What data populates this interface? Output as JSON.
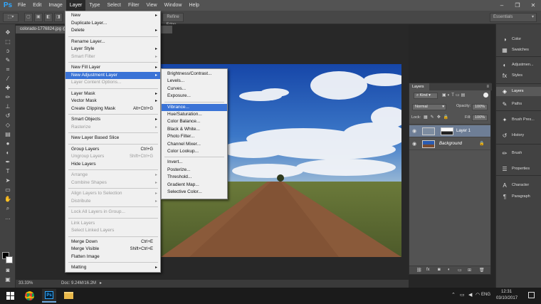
{
  "app": {
    "logo": "Ps"
  },
  "menubar": {
    "items": [
      "File",
      "Edit",
      "Image",
      "Layer",
      "Type",
      "Select",
      "Filter",
      "View",
      "Window",
      "Help"
    ],
    "active": "Layer"
  },
  "options_bar": {
    "refine_edge": "Refine Edge...",
    "workspace": "Essentials"
  },
  "document": {
    "tab_title": "colorado-1776824.jpg @ 16.7% (RGB/8#)",
    "zoom": "33.33%",
    "doc_size": "Doc: 9.24M/16.2M"
  },
  "layer_menu": {
    "items": [
      {
        "label": "New",
        "submenu": true
      },
      {
        "label": "Duplicate Layer..."
      },
      {
        "label": "Delete",
        "submenu": true
      },
      {
        "sep": true
      },
      {
        "label": "Rename Layer..."
      },
      {
        "label": "Layer Style",
        "submenu": true
      },
      {
        "label": "Smart Filter",
        "submenu": true,
        "disabled": true
      },
      {
        "sep": true
      },
      {
        "label": "New Fill Layer",
        "submenu": true
      },
      {
        "label": "New Adjustment Layer",
        "submenu": true,
        "highlight": true
      },
      {
        "label": "Layer Content Options...",
        "disabled": true
      },
      {
        "sep": true
      },
      {
        "label": "Layer Mask",
        "submenu": true
      },
      {
        "label": "Vector Mask",
        "submenu": true
      },
      {
        "label": "Create Clipping Mask",
        "shortcut": "Alt+Ctrl+G"
      },
      {
        "sep": true
      },
      {
        "label": "Smart Objects",
        "submenu": true
      },
      {
        "label": "Rasterize",
        "submenu": true,
        "disabled": true
      },
      {
        "sep": true
      },
      {
        "label": "New Layer Based Slice"
      },
      {
        "sep": true
      },
      {
        "label": "Group Layers",
        "shortcut": "Ctrl+G"
      },
      {
        "label": "Ungroup Layers",
        "shortcut": "Shift+Ctrl+G",
        "disabled": true
      },
      {
        "label": "Hide Layers"
      },
      {
        "sep": true
      },
      {
        "label": "Arrange",
        "submenu": true,
        "disabled": true
      },
      {
        "label": "Combine Shapes",
        "submenu": true,
        "disabled": true
      },
      {
        "sep": true
      },
      {
        "label": "Align Layers to Selection",
        "submenu": true,
        "disabled": true
      },
      {
        "label": "Distribute",
        "submenu": true,
        "disabled": true
      },
      {
        "sep": true
      },
      {
        "label": "Lock All Layers in Group...",
        "disabled": true
      },
      {
        "sep": true
      },
      {
        "label": "Link Layers",
        "disabled": true
      },
      {
        "label": "Select Linked Layers",
        "disabled": true
      },
      {
        "sep": true
      },
      {
        "label": "Merge Down",
        "shortcut": "Ctrl+E"
      },
      {
        "label": "Merge Visible",
        "shortcut": "Shift+Ctrl+E"
      },
      {
        "label": "Flatten Image"
      },
      {
        "sep": true
      },
      {
        "label": "Matting",
        "submenu": true
      }
    ]
  },
  "adjustment_submenu": {
    "items": [
      {
        "label": "Brightness/Contrast..."
      },
      {
        "label": "Levels..."
      },
      {
        "label": "Curves..."
      },
      {
        "label": "Exposure..."
      },
      {
        "sep": true
      },
      {
        "label": "Vibrance...",
        "highlight": true
      },
      {
        "label": "Hue/Saturation..."
      },
      {
        "label": "Color Balance..."
      },
      {
        "label": "Black & White..."
      },
      {
        "label": "Photo Filter..."
      },
      {
        "label": "Channel Mixer..."
      },
      {
        "label": "Color Lookup..."
      },
      {
        "sep": true
      },
      {
        "label": "Invert..."
      },
      {
        "label": "Posterize..."
      },
      {
        "label": "Threshold..."
      },
      {
        "label": "Gradient Map..."
      },
      {
        "label": "Selective Color..."
      }
    ]
  },
  "layers_panel": {
    "tab": "Layers",
    "filter": "Kind",
    "blend_mode": "Normal",
    "opacity_label": "Opacity:",
    "opacity": "100%",
    "lock_label": "Lock:",
    "fill_label": "Fill:",
    "fill": "100%",
    "layers": [
      {
        "name": "Layer 1",
        "selected": true
      },
      {
        "name": "Background",
        "italic": true,
        "locked": true
      }
    ]
  },
  "right_panels": {
    "items": [
      {
        "label": "Color",
        "icon": "color-icon"
      },
      {
        "label": "Swatches",
        "icon": "swatches-icon"
      },
      {
        "label": "Adjustmen...",
        "icon": "adjustments-icon"
      },
      {
        "label": "Styles",
        "icon": "styles-icon"
      },
      {
        "label": "Layers",
        "icon": "layers-icon",
        "selected": true
      },
      {
        "label": "Paths",
        "icon": "paths-icon"
      },
      {
        "label": "Brush Pres...",
        "icon": "brush-presets-icon"
      },
      {
        "label": "History",
        "icon": "history-icon"
      },
      {
        "label": "Brush",
        "icon": "brush-icon"
      },
      {
        "label": "Properties",
        "icon": "properties-icon"
      },
      {
        "label": "Character",
        "icon": "character-icon"
      },
      {
        "label": "Paragraph",
        "icon": "paragraph-icon"
      }
    ]
  },
  "taskbar": {
    "time": "12:31",
    "date": "03/10/2017",
    "lang": "ENG"
  },
  "colors": {
    "highlight": "#3a73d6",
    "ps_blue": "#31a8ff",
    "menu_bg": "#f0f0f0"
  }
}
